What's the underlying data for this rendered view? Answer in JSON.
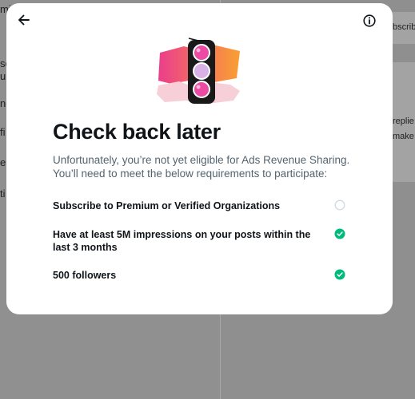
{
  "background": {
    "left_fragments": [
      "mi",
      "so",
      "ur",
      "nc",
      "fi",
      "es",
      "ti"
    ],
    "right_fragments": [
      "bscribe",
      "replie",
      "make"
    ]
  },
  "modal": {
    "title": "Check back later",
    "description": "Unfortunately, you’re not yet eligible for Ads Revenue Sharing. You’ll need to meet the below requirements to participate:",
    "requirements": [
      {
        "label": "Subscribe to Premium or Verified Organizations",
        "met": false
      },
      {
        "label": "Have at least 5M impressions on your posts within the last 3 months",
        "met": true
      },
      {
        "label": "500 followers",
        "met": true
      }
    ]
  },
  "icons": {
    "back": "arrow-left-icon",
    "info": "info-icon",
    "met": "check-circle-icon",
    "unmet": "empty-circle-icon",
    "illustration": "traffic-light-illustration"
  },
  "colors": {
    "success": "#00ba7c",
    "unmet_border": "#cfd9de",
    "title": "#0f1419",
    "body": "#536471"
  }
}
